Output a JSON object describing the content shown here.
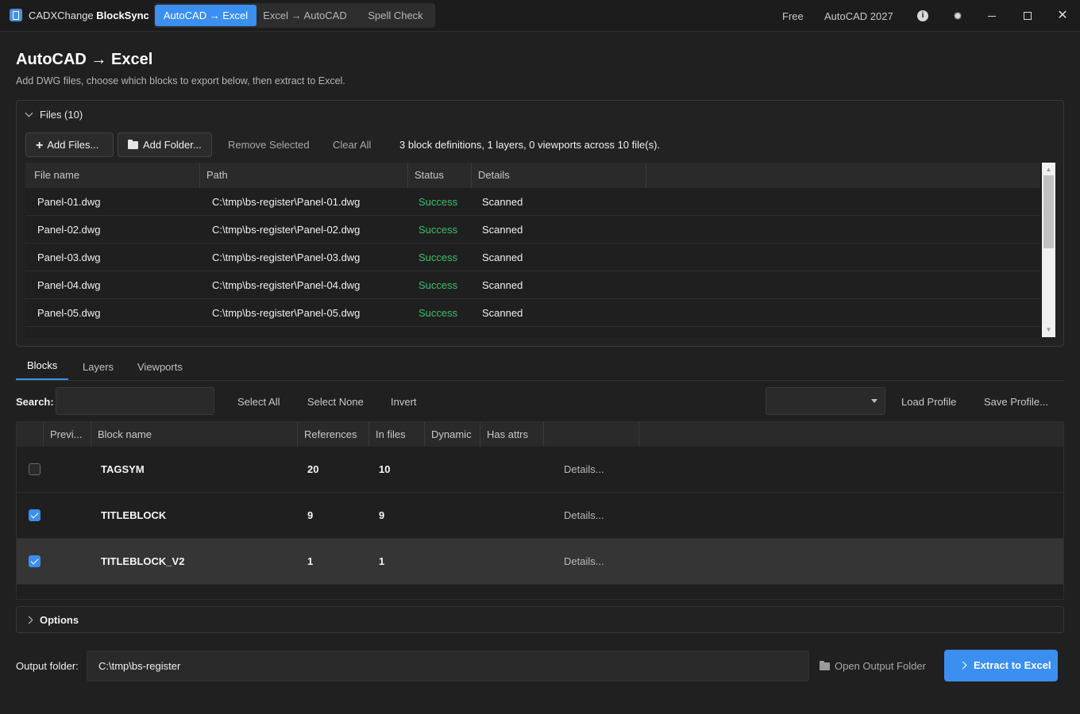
{
  "titlebar": {
    "app_name_prefix": "CADXChange ",
    "app_name_bold": "BlockSync",
    "modes": [
      {
        "label": "AutoCAD → Excel",
        "active": true
      },
      {
        "label": "Excel → AutoCAD",
        "active": false
      },
      {
        "label": "Spell Check",
        "active": false
      }
    ],
    "license": "Free",
    "autocad_version": "AutoCAD 2027",
    "icons": [
      "info-icon",
      "settings-icon",
      "minimize-icon",
      "maximize-icon",
      "close-icon"
    ]
  },
  "header": {
    "title": "AutoCAD → Excel",
    "subtitle": "Add DWG files, choose which blocks to export below, then extract to Excel."
  },
  "files": {
    "header": "Files (10)",
    "add_files": "Add Files...",
    "add_folder": "Add Folder...",
    "remove_selected": "Remove Selected",
    "clear_all": "Clear All",
    "summary": "3 block definitions, 1 layers, 0 viewports across 10 file(s).",
    "columns": [
      "File name",
      "Path",
      "Status",
      "Details"
    ],
    "rows": [
      {
        "name": "Panel-01.dwg",
        "path": "C:\\tmp\\bs-register\\Panel-01.dwg",
        "status": "Success",
        "details": "Scanned"
      },
      {
        "name": "Panel-02.dwg",
        "path": "C:\\tmp\\bs-register\\Panel-02.dwg",
        "status": "Success",
        "details": "Scanned"
      },
      {
        "name": "Panel-03.dwg",
        "path": "C:\\tmp\\bs-register\\Panel-03.dwg",
        "status": "Success",
        "details": "Scanned"
      },
      {
        "name": "Panel-04.dwg",
        "path": "C:\\tmp\\bs-register\\Panel-04.dwg",
        "status": "Success",
        "details": "Scanned"
      },
      {
        "name": "Panel-05.dwg",
        "path": "C:\\tmp\\bs-register\\Panel-05.dwg",
        "status": "Success",
        "details": "Scanned"
      }
    ]
  },
  "tabs": [
    {
      "label": "Blocks",
      "active": true
    },
    {
      "label": "Layers",
      "active": false
    },
    {
      "label": "Viewports",
      "active": false
    }
  ],
  "toolbar": {
    "search_label": "Search:",
    "search_value": "",
    "select_all": "Select All",
    "select_none": "Select None",
    "invert": "Invert",
    "profile_value": "",
    "load_profile": "Load Profile",
    "save_profile": "Save Profile..."
  },
  "blocks": {
    "columns": [
      "",
      "Previ...",
      "Block name",
      "References",
      "In files",
      "Dynamic",
      "Has attrs"
    ],
    "rows": [
      {
        "checked": false,
        "name": "TAGSYM",
        "references": "20",
        "in_files": "10",
        "dynamic": "",
        "has_attrs": "",
        "details": "Details..."
      },
      {
        "checked": true,
        "name": "TITLEBLOCK",
        "references": "9",
        "in_files": "9",
        "dynamic": "",
        "has_attrs": "",
        "details": "Details..."
      },
      {
        "checked": true,
        "name": "TITLEBLOCK_V2",
        "references": "1",
        "in_files": "1",
        "dynamic": "",
        "has_attrs": "",
        "details": "Details...",
        "selected": true
      }
    ]
  },
  "options": {
    "label": "Options"
  },
  "output": {
    "label": "Output folder:",
    "path": "C:\\tmp\\bs-register",
    "open_folder": "Open Output Folder",
    "extract": "Extract to Excel"
  },
  "colors": {
    "accent": "#3b8ff0",
    "success": "#3fbf6a",
    "background": "#202020"
  }
}
